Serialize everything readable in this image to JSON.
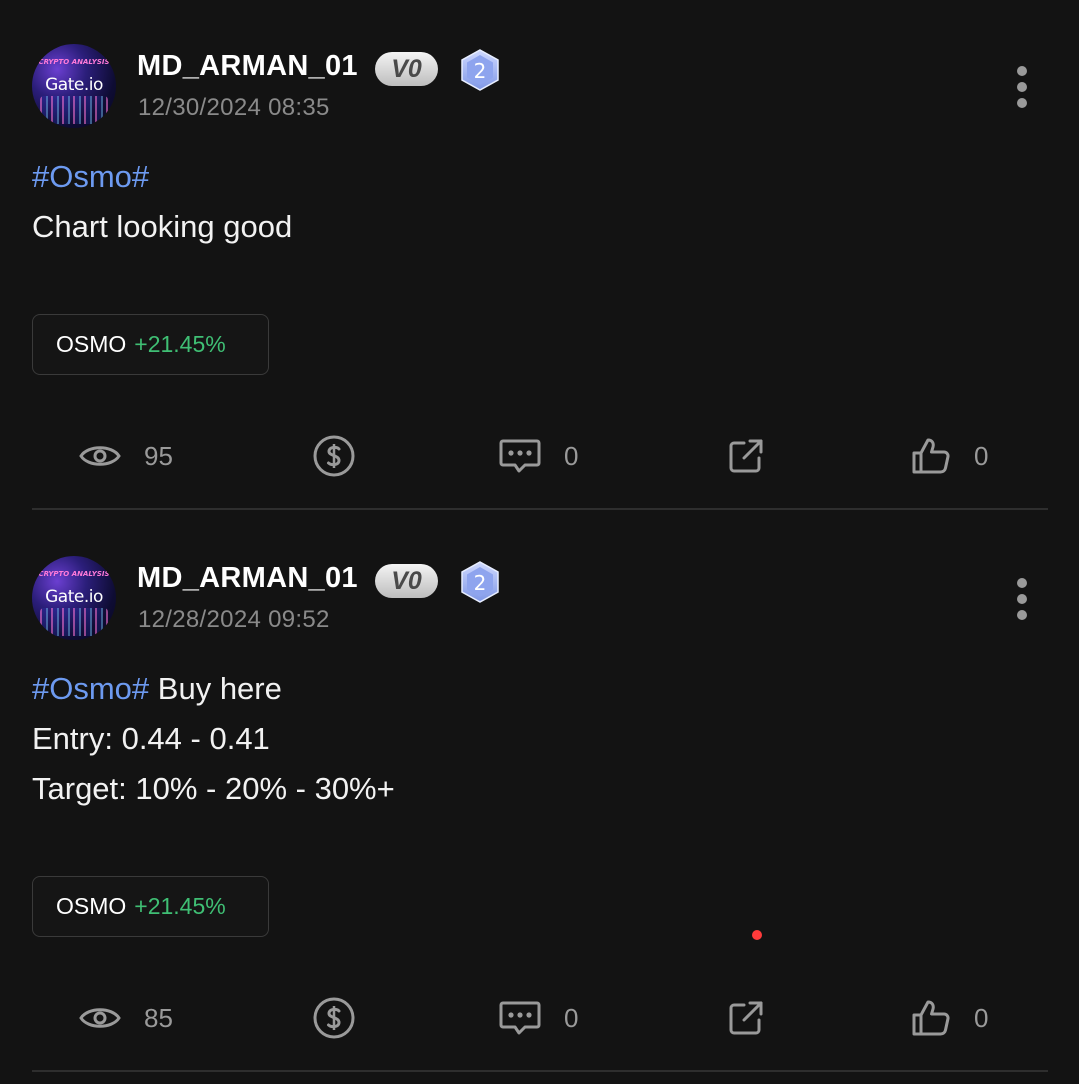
{
  "colors": {
    "background": "#131313",
    "hashtag": "#6d9af0",
    "positive_change": "#3fbf74",
    "muted_text": "#8a8a8a",
    "icon_gray": "#9a9a9a",
    "notification_dot": "#ff3b3b"
  },
  "posts": [
    {
      "author": {
        "name": "MD_ARMAN_01",
        "vip_label": "V0",
        "level": "2",
        "avatar_caption": "CRYPTO ANALYSIS",
        "avatar_logo": "Gate.io"
      },
      "timestamp": "12/30/2024 08:35",
      "lines": [
        {
          "hashtag": "#Osmo#",
          "text": ""
        },
        {
          "hashtag": "",
          "text": "Chart looking good"
        }
      ],
      "coin": {
        "symbol": "OSMO",
        "change": "+21.45%"
      },
      "stats": {
        "views": "95",
        "comments": "0",
        "likes": "0"
      },
      "icons": [
        "eye-icon",
        "tip-coin-icon",
        "comment-icon",
        "share-icon",
        "thumbs-up-icon",
        "more-vertical-icon"
      ]
    },
    {
      "author": {
        "name": "MD_ARMAN_01",
        "vip_label": "V0",
        "level": "2",
        "avatar_caption": "CRYPTO ANALYSIS",
        "avatar_logo": "Gate.io"
      },
      "timestamp": "12/28/2024 09:52",
      "lines": [
        {
          "hashtag": "#Osmo#",
          "text": " Buy here"
        },
        {
          "hashtag": "",
          "text": "Entry: 0.44 - 0.41"
        },
        {
          "hashtag": "",
          "text": "Target: 10% - 20% - 30%+"
        }
      ],
      "coin": {
        "symbol": "OSMO",
        "change": "+21.45%"
      },
      "stats": {
        "views": "85",
        "comments": "0",
        "likes": "0"
      },
      "icons": [
        "eye-icon",
        "tip-coin-icon",
        "comment-icon",
        "share-icon",
        "thumbs-up-icon",
        "more-vertical-icon"
      ]
    }
  ]
}
